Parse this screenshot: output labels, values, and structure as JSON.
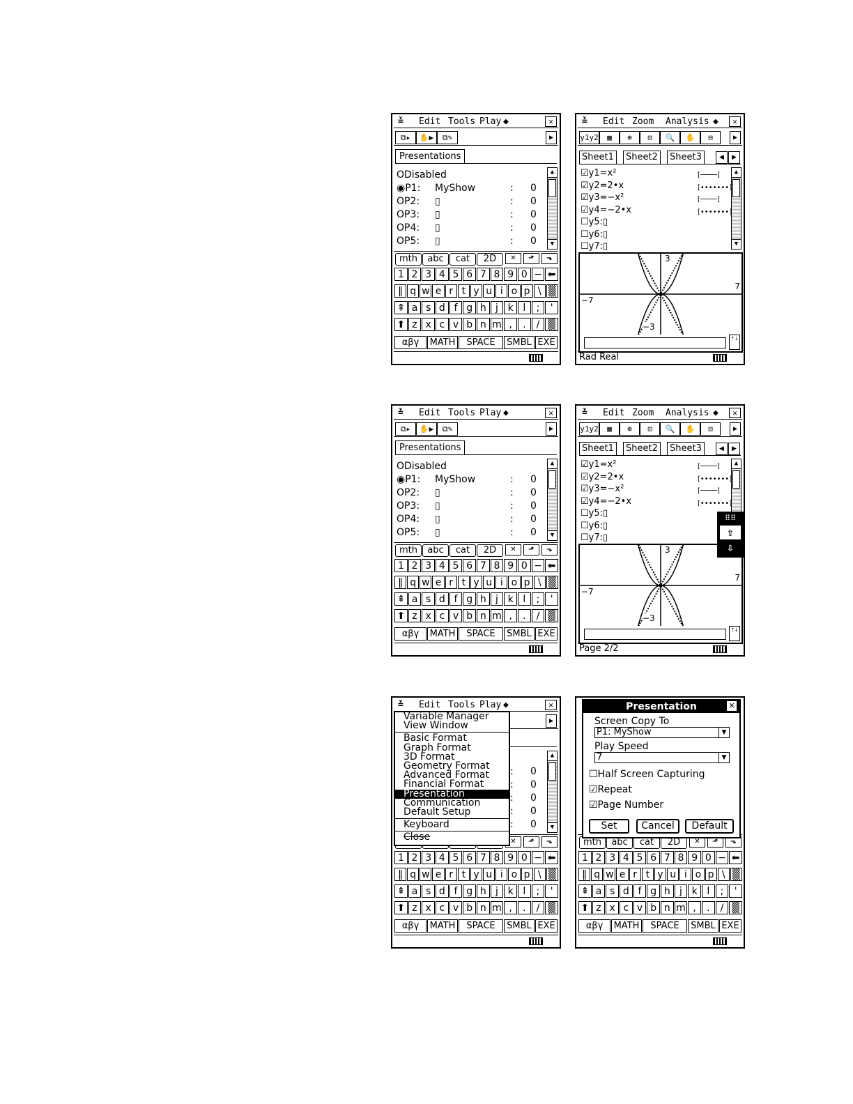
{
  "calc": {
    "menu_chev": "≚",
    "diamond": "◆",
    "close_glyph": "✕",
    "pres_menus": [
      "Edit",
      "Tools",
      "Play"
    ],
    "graph_menus": [
      "Edit",
      "Zoom",
      "Analysis"
    ],
    "pres_toolbar": [
      "⧉▸",
      "✋▶",
      "⧉✎"
    ],
    "graph_toolbar": [
      "y1y2",
      "▦",
      "⊕",
      "⊡",
      "🔍",
      "✋",
      "⊟"
    ],
    "pres_tab": "Presentations",
    "pres_rows": [
      {
        "label": "ODisabled",
        "name": "",
        "colon": "",
        "num": ""
      },
      {
        "label": "◉P1:",
        "name": "MyShow",
        "colon": ":",
        "num": "0"
      },
      {
        "label": "OP2:",
        "name": "▯",
        "colon": ":",
        "num": "0"
      },
      {
        "label": "OP3:",
        "name": "▯",
        "colon": ":",
        "num": "0"
      },
      {
        "label": "OP4:",
        "name": "▯",
        "colon": ":",
        "num": "0"
      },
      {
        "label": "OP5:",
        "name": "▯",
        "colon": ":",
        "num": "0"
      }
    ],
    "sheets": [
      "Sheet1",
      "Sheet2",
      "Sheet3"
    ],
    "y_rows": [
      {
        "text": "☑y1=x²",
        "style": "[────]"
      },
      {
        "text": "☑y2=2•x",
        "style": "[•••••••]"
      },
      {
        "text": "☑y3=−x²",
        "style": "[────]"
      },
      {
        "text": "☑y4=−2•x",
        "style": "[•••••••]"
      },
      {
        "text": "☐y5:▯",
        "style": ""
      },
      {
        "text": "☐y6:▯",
        "style": ""
      },
      {
        "text": "☐y7:▯",
        "style": ""
      }
    ],
    "graph_labels": {
      "ytop": "3",
      "ybot": "−3",
      "xleft": "−7",
      "xright": "7"
    },
    "kb_tabs": [
      "mth",
      "abc",
      "cat",
      "2D"
    ],
    "kb_arrows": [
      "✕",
      "⬏",
      "⬎"
    ],
    "kb_rows": [
      [
        "1",
        "2",
        "3",
        "4",
        "5",
        "6",
        "7",
        "8",
        "9",
        "0",
        "−",
        "⬅"
      ],
      [
        "‖",
        "q",
        "w",
        "e",
        "r",
        "t",
        "y",
        "u",
        "i",
        "o",
        "p",
        "\\",
        "▒"
      ],
      [
        "⇞",
        "a",
        "s",
        "d",
        "f",
        "g",
        "h",
        "j",
        "k",
        "l",
        ";",
        "'"
      ],
      [
        "⬆",
        "z",
        "x",
        "c",
        "v",
        "b",
        "n",
        "m",
        ",",
        ".",
        "/",
        "▒"
      ]
    ],
    "bottom_keys": [
      "αβγ",
      "MATH",
      "SPACE",
      "SMBL",
      "EXE"
    ],
    "status_graph1": "Rad   Real",
    "status_graph2": "Page  2/2",
    "popup_top": "⠿⠿",
    "popup_up": "⇧",
    "popup_down": "⇩",
    "dropdown": {
      "group1": [
        "Variable Manager",
        "View Window"
      ],
      "group2": [
        "Basic Format",
        "Graph Format",
        "3D Format",
        "Geometry Format",
        "Advanced Format",
        "Financial Format",
        "Presentation",
        "Communication",
        "Default Setup"
      ],
      "group3": [
        "Keyboard"
      ],
      "close": "Close"
    },
    "dialog": {
      "title": "Presentation",
      "screen_copy_label": "Screen Copy To",
      "screen_copy_value": "P1: MyShow",
      "play_speed_label": "Play Speed",
      "play_speed_value": "7",
      "half_screen": "☐Half Screen Capturing",
      "repeat": "☑Repeat",
      "page_number": "☑Page Number",
      "set": "Set",
      "cancel": "Cancel",
      "default": "Default"
    }
  }
}
